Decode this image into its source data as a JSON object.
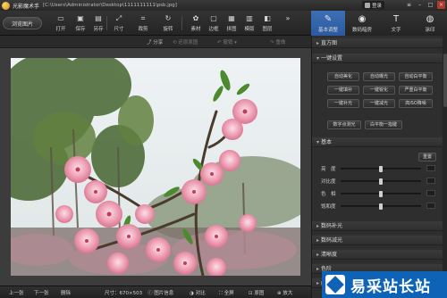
{
  "window": {
    "app_title": "光影魔术手",
    "path": "[C:\\Users\\Administrator\\Desktop\\1111111111\\psb.jpg]",
    "login_label": "登录"
  },
  "toolbar": {
    "browse_label": "浏览图片",
    "tools": [
      {
        "label": "打开",
        "icon": "folder-icon"
      },
      {
        "label": "保存",
        "icon": "save-icon"
      },
      {
        "label": "另存",
        "icon": "save-as-icon"
      },
      {
        "label": "尺寸",
        "icon": "resize-icon"
      },
      {
        "label": "裁剪",
        "icon": "crop-icon"
      },
      {
        "label": "旋转",
        "icon": "rotate-icon"
      },
      {
        "label": "素材",
        "icon": "material-icon"
      },
      {
        "label": "边框",
        "icon": "border-icon"
      },
      {
        "label": "拼图",
        "icon": "collage-icon"
      },
      {
        "label": "模版",
        "icon": "template-icon"
      },
      {
        "label": "图层",
        "icon": "layer-icon"
      }
    ]
  },
  "mode_tabs": [
    {
      "label": "基本调整",
      "icon": "adjust-icon",
      "active": true
    },
    {
      "label": "数码暗房",
      "icon": "camera-icon",
      "active": false
    },
    {
      "label": "文字",
      "icon": "text-icon",
      "active": false
    },
    {
      "label": "涂印",
      "icon": "stamp-icon",
      "active": false
    }
  ],
  "subbar": {
    "share": "分享",
    "restore": "还原原图",
    "undo": "撤销",
    "redo": "重做"
  },
  "status": {
    "prev": "上一张",
    "next": "下一张",
    "delete": "删除",
    "size": "尺寸：670×503",
    "info": "图片信息",
    "compare": "对比",
    "fullscreen": "全屏",
    "original": "原图",
    "zoom": "放大"
  },
  "panel": {
    "histogram": "直方图",
    "one_key": "一键设置",
    "one_key_buttons": [
      "自动美化",
      "自动曝光",
      "自动白平衡",
      "一键填补",
      "一键锐化",
      "严重白平衡",
      "一键补光",
      "一键减光",
      "高ISO降噪"
    ],
    "extra_buttons": [
      "数字点测光",
      "白平衡一指键"
    ],
    "basic": "基本",
    "reset": "重置",
    "sliders": [
      {
        "label": "亮　度",
        "value": 0.5
      },
      {
        "label": "对比度",
        "value": 0.5
      },
      {
        "label": "色　相",
        "value": 0.5
      },
      {
        "label": "饱和度",
        "value": 0.5
      }
    ],
    "more_sections": [
      "数码补光",
      "数码减光",
      "清晰度",
      "色阶",
      "曲线"
    ]
  },
  "watermark": {
    "text": "易采站长站"
  },
  "colors": {
    "accent": "#2b5aa0",
    "watermark_bg": "#0e63b6",
    "blossom": "#e98fa6"
  }
}
